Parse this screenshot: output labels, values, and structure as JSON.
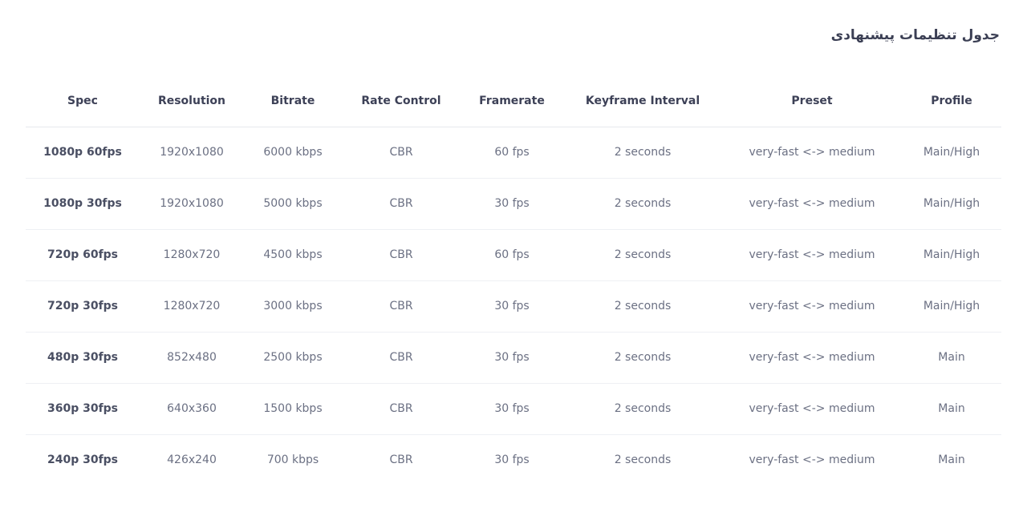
{
  "title": "جدول تنظیمات پیشنهادی",
  "table": {
    "headers": [
      "Spec",
      "Resolution",
      "Bitrate",
      "Rate Control",
      "Framerate",
      "Keyframe Interval",
      "Preset",
      "Profile"
    ],
    "rows": [
      [
        "1080p 60fps",
        "1920x1080",
        "6000 kbps",
        "CBR",
        "60 fps",
        "2 seconds",
        "very-fast <-> medium",
        "Main/High"
      ],
      [
        "1080p 30fps",
        "1920x1080",
        "5000 kbps",
        "CBR",
        "30 fps",
        "2 seconds",
        "very-fast <-> medium",
        "Main/High"
      ],
      [
        "720p 60fps",
        "1280x720",
        "4500 kbps",
        "CBR",
        "60 fps",
        "2 seconds",
        "very-fast <-> medium",
        "Main/High"
      ],
      [
        "720p 30fps",
        "1280x720",
        "3000 kbps",
        "CBR",
        "30 fps",
        "2 seconds",
        "very-fast <-> medium",
        "Main/High"
      ],
      [
        "480p 30fps",
        "852x480",
        "2500 kbps",
        "CBR",
        "30 fps",
        "2 seconds",
        "very-fast <-> medium",
        "Main"
      ],
      [
        "360p 30fps",
        "640x360",
        "1500 kbps",
        "CBR",
        "30 fps",
        "2 seconds",
        "very-fast <-> medium",
        "Main"
      ],
      [
        "240p 30fps",
        "426x240",
        "700 kbps",
        "CBR",
        "30 fps",
        "2 seconds",
        "very-fast <-> medium",
        "Main"
      ]
    ]
  }
}
